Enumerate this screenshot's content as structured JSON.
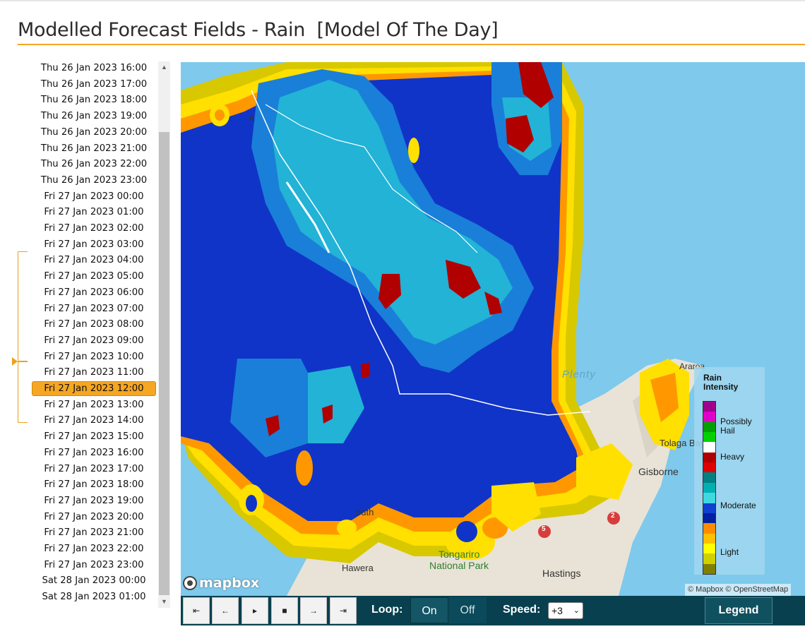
{
  "page_title": "Modelled Forecast Fields - Rain  [Model Of The Day]",
  "times": [
    "Thu 26 Jan 2023 16:00",
    "Thu 26 Jan 2023 17:00",
    "Thu 26 Jan 2023 18:00",
    "Thu 26 Jan 2023 19:00",
    "Thu 26 Jan 2023 20:00",
    "Thu 26 Jan 2023 21:00",
    "Thu 26 Jan 2023 22:00",
    "Thu 26 Jan 2023 23:00",
    "Fri 27 Jan 2023 00:00",
    "Fri 27 Jan 2023 01:00",
    "Fri 27 Jan 2023 02:00",
    "Fri 27 Jan 2023 03:00",
    "Fri 27 Jan 2023 04:00",
    "Fri 27 Jan 2023 05:00",
    "Fri 27 Jan 2023 06:00",
    "Fri 27 Jan 2023 07:00",
    "Fri 27 Jan 2023 08:00",
    "Fri 27 Jan 2023 09:00",
    "Fri 27 Jan 2023 10:00",
    "Fri 27 Jan 2023 11:00",
    "Fri 27 Jan 2023 12:00",
    "Fri 27 Jan 2023 13:00",
    "Fri 27 Jan 2023 14:00",
    "Fri 27 Jan 2023 15:00",
    "Fri 27 Jan 2023 16:00",
    "Fri 27 Jan 2023 17:00",
    "Fri 27 Jan 2023 18:00",
    "Fri 27 Jan 2023 19:00",
    "Fri 27 Jan 2023 20:00",
    "Fri 27 Jan 2023 21:00",
    "Fri 27 Jan 2023 22:00",
    "Fri 27 Jan 2023 23:00",
    "Sat 28 Jan 2023 00:00",
    "Sat 28 Jan 2023 01:00"
  ],
  "selected_time": "Fri 27 Jan 2023 12:00",
  "scrollbar": {
    "up_icon": "triangle-up-icon",
    "down_icon": "triangle-down-icon"
  },
  "map": {
    "labels": {
      "araroa": "Araroa",
      "plenty": "Plenty",
      "tologa": "Tolaga Bay",
      "gisborne": "Gisborne",
      "south": "outh",
      "tongariro_1": "Tongariro",
      "tongariro_2": "National Park",
      "hawera": "Hawera",
      "hastings": "Hastings",
      "a": "A",
      "route_5": "5",
      "route_2": "2"
    },
    "logo_text": "mapbox",
    "attribution": "© Mapbox © OpenStreetMap"
  },
  "legend": {
    "title_line1": "Rain",
    "title_line2": "Intensity",
    "labels": [
      "Possibly",
      "Hail",
      "Heavy",
      "Moderate",
      "Light"
    ],
    "colors": [
      "#a0008c",
      "#e000c8",
      "#00a000",
      "#00d000",
      "#ffffff",
      "#b00000",
      "#e00000",
      "#008080",
      "#00b0b0",
      "#40d8e0",
      "#1040d0",
      "#0020a0",
      "#ff8c00",
      "#ffc000",
      "#ffff00",
      "#d0d000",
      "#808000"
    ]
  },
  "controls": {
    "buttons": [
      "first-frame-icon",
      "step-back-icon",
      "play-icon",
      "stop-icon",
      "step-forward-icon",
      "last-frame-icon"
    ],
    "loop_label": "Loop:",
    "loop_on": "On",
    "loop_off": "Off",
    "speed_label": "Speed:",
    "speed_value": "+3",
    "legend_button": "Legend"
  }
}
